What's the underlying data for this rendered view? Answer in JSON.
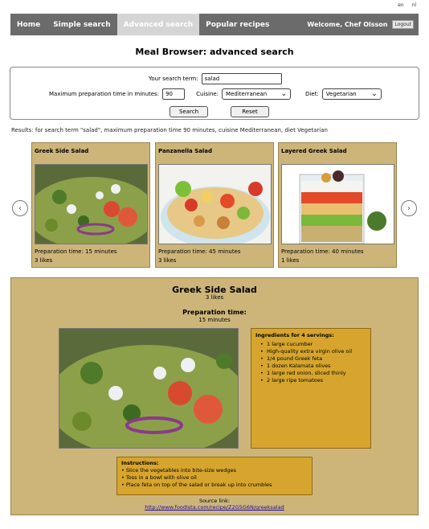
{
  "language": {
    "en": "en",
    "nl": "nl"
  },
  "nav": {
    "items": [
      {
        "label": "Home"
      },
      {
        "label": "Simple search"
      },
      {
        "label": "Advanced search"
      },
      {
        "label": "Popular recipes"
      }
    ],
    "welcome": "Welcome, Chef Olsson",
    "logout": "Logout"
  },
  "page": {
    "title": "Meal Browser: advanced search"
  },
  "search": {
    "term_label": "Your search term:",
    "term_value": "salad",
    "max_time_label": "Maximum preparation time in minutes:",
    "max_time_value": "90",
    "cuisine_label": "Cuisine:",
    "cuisine_value": "Mediterranean",
    "diet_label": "Diet:",
    "diet_value": "Vegetarian",
    "search_button": "Search",
    "reset_button": "Reset"
  },
  "results_text": "Results: for search term \"salad\", maximum preparation time 90 minutes, cuisine Mediterranean, diet Vegetarian",
  "cards": [
    {
      "title": "Greek Side Salad",
      "prep": "Preparation time: 15 minutes",
      "likes": "3 likes"
    },
    {
      "title": "Panzanella Salad",
      "prep": "Preparation time: 45 minutes",
      "likes": "3 likes"
    },
    {
      "title": "Layered Greek Salad",
      "prep": "Preparation time: 40 minutes",
      "likes": "1 likes"
    }
  ],
  "detail": {
    "title": "Greek Side Salad",
    "likes": "3 likes",
    "prep_label": "Preparation time:",
    "prep_value": "15 minutes",
    "ingredients_header": "Ingredients for 4 servings:",
    "ingredients": [
      "1 large cucumber",
      "High-quality extra virgin olive oil",
      "1/4 pound Greek feta",
      "1 dozen Kalamata olives",
      "1 large red onion, sliced thinly",
      "2 large ripe tomatoes"
    ],
    "instructions_header": "Instructions:",
    "instructions": [
      "• Slice the vegetables into bite-size wedges",
      "• Toss in a bowl with olive oil",
      "• Place feta on top of the salad or break up into crumbles"
    ],
    "source_label": "Source link:",
    "source_url": "http://www.foodista.com/recipe/Z2G5G6N/greeksalad"
  }
}
